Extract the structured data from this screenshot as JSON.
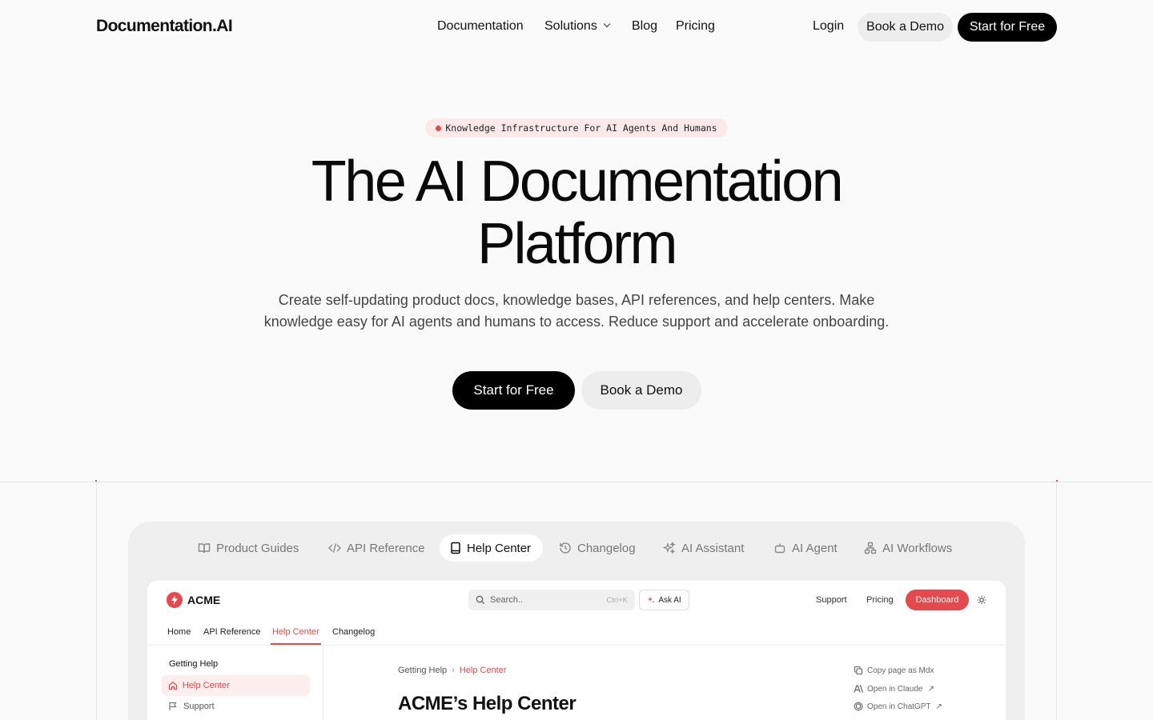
{
  "nav": {
    "logo": "Documentation.AI",
    "links": [
      "Documentation",
      "Solutions",
      "Blog",
      "Pricing"
    ],
    "login": "Login",
    "book_demo": "Book a Demo",
    "start_free": "Start for Free"
  },
  "hero": {
    "badge": "Knowledge Infrastructure For AI Agents And Humans",
    "title_line1": "The AI Documentation",
    "title_line2": "Platform",
    "subtitle_line1": "Create self-updating product docs, knowledge bases, API references, and help centers. Make",
    "subtitle_line2": "knowledge easy for AI agents and humans to access. Reduce support and accelerate onboarding.",
    "cta_primary": "Start for Free",
    "cta_secondary": "Book a Demo"
  },
  "tabs": [
    {
      "label": "Product Guides",
      "icon": "book-open-icon"
    },
    {
      "label": "API Reference",
      "icon": "code-icon"
    },
    {
      "label": "Help Center",
      "icon": "book-icon",
      "active": true
    },
    {
      "label": "Changelog",
      "icon": "history-icon"
    },
    {
      "label": "AI Assistant",
      "icon": "sparkles-icon"
    },
    {
      "label": "AI Agent",
      "icon": "bot-icon"
    },
    {
      "label": "AI Workflows",
      "icon": "workflow-icon"
    }
  ],
  "demo_app": {
    "brand": "ACME",
    "search_placeholder": "Search..",
    "search_shortcut": "Ctrl+K",
    "ask_ai": "Ask AI",
    "links": [
      "Support",
      "Pricing"
    ],
    "dashboard": "Dashboard",
    "subtabs": [
      "Home",
      "API Reference",
      "Help Center",
      "Changelog"
    ],
    "active_subtab": "Help Center",
    "sidebar_heading": "Getting Help",
    "sidebar_items": [
      "Help Center",
      "Support"
    ],
    "breadcrumb": [
      "Getting Help",
      "Help Center"
    ],
    "page_title": "ACME’s Help Center",
    "actions": [
      "Copy page as Mdx",
      "Open in Claude",
      "Open in ChatGPT"
    ]
  },
  "colors": {
    "accent": "#e5484d",
    "dark": "#000000",
    "background": "#fafafa"
  }
}
